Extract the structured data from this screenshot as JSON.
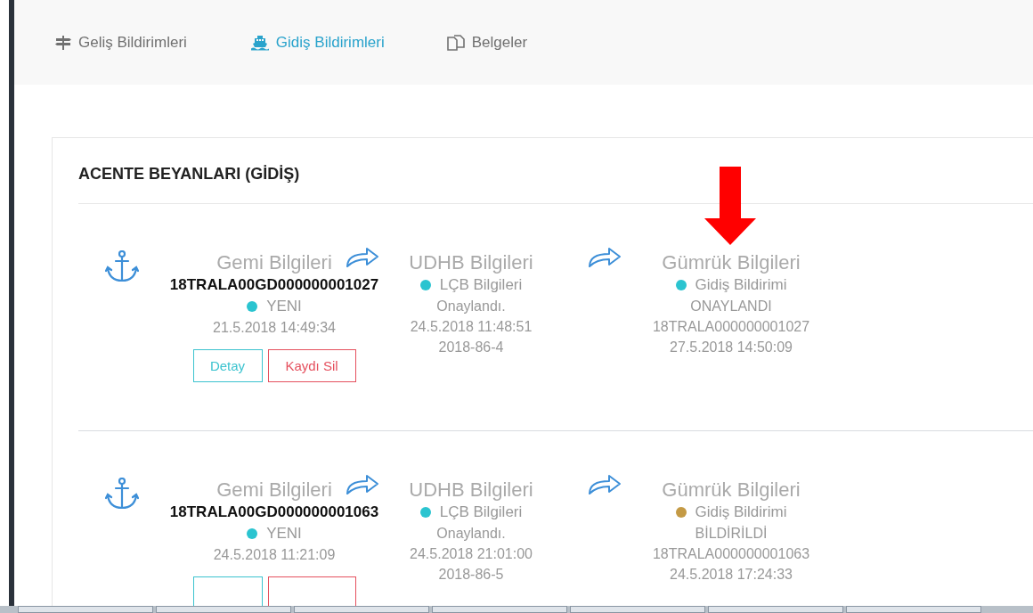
{
  "nav": {
    "tabs": [
      {
        "label": "Geliş Bildirimleri",
        "kind": "arrivals",
        "selected": false
      },
      {
        "label": "Gidiş Bildirimleri",
        "kind": "departures",
        "selected": true
      },
      {
        "label": "Belgeler",
        "kind": "documents",
        "selected": false
      }
    ]
  },
  "panel": {
    "title": "ACENTE BEYANLARI (GİDİŞ)",
    "records": [
      {
        "ship": {
          "title": "Gemi Bilgileri",
          "number": "18TRALA00GD000000001027",
          "status": {
            "label": "YENI",
            "color": "#2bc4d0"
          },
          "date": "21.5.2018 14:49:34"
        },
        "udhb": {
          "title": "UDHB Bilgileri",
          "status": {
            "label": "LÇB Bilgileri",
            "color": "#2bc4d0"
          },
          "lines": [
            "Onaylandı.",
            "24.5.2018 11:48:51",
            "2018-86-4"
          ]
        },
        "customs": {
          "title": "Gümrük Bilgileri",
          "status": {
            "label": "Gidiş Bildirimi",
            "color": "#2bc4d0"
          },
          "lines": [
            "ONAYLANDI",
            "18TRALA000000001027",
            "27.5.2018 14:50:09"
          ]
        },
        "buttons": [
          {
            "kind": "detail",
            "label": "Detay"
          },
          {
            "kind": "delete",
            "label": "Kaydı Sil"
          }
        ]
      },
      {
        "ship": {
          "title": "Gemi Bilgileri",
          "number": "18TRALA00GD000000001063",
          "status": {
            "label": "YENI",
            "color": "#2bc4d0"
          },
          "date": "24.5.2018 11:21:09"
        },
        "udhb": {
          "title": "UDHB Bilgileri",
          "status": {
            "label": "LÇB Bilgileri",
            "color": "#2bc4d0"
          },
          "lines": [
            "Onaylandı.",
            "24.5.2018 21:01:00",
            "2018-86-5"
          ]
        },
        "customs": {
          "title": "Gümrük Bilgileri",
          "status": {
            "label": "Gidiş Bildirimi",
            "color": "#c49a45"
          },
          "lines": [
            "BİLDİRİLDİ",
            "18TRALA000000001063",
            "24.5.2018 17:24:33"
          ]
        },
        "buttons": [
          {
            "kind": "detail"
          },
          {
            "kind": "delete"
          }
        ]
      }
    ]
  }
}
